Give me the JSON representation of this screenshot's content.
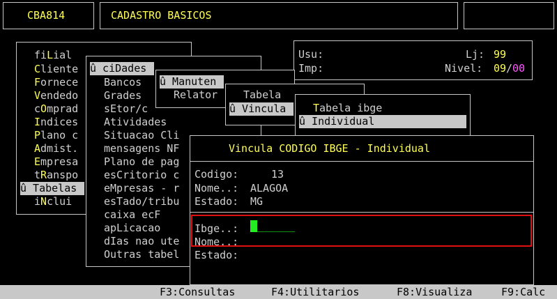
{
  "header": {
    "code": "CBA814",
    "title": "CADASTRO BASICOS"
  },
  "main_menu": {
    "items": [
      {
        "hot": "fi",
        "hot_key": "L",
        "rest": "ial",
        "selected": false
      },
      {
        "hot": "C",
        "rest": "liente",
        "selected": false
      },
      {
        "hot": "F",
        "rest": "ornece",
        "selected": false
      },
      {
        "hot": "V",
        "rest": "endedo",
        "selected": false
      },
      {
        "hot": "c",
        "hot_key": "O",
        "rest": "mprad",
        "selected": false
      },
      {
        "hot": "I",
        "rest": "ndices",
        "selected": false
      },
      {
        "hot": "P",
        "rest": "lano c",
        "selected": false
      },
      {
        "hot": "A",
        "rest": "dmist.",
        "selected": false
      },
      {
        "hot": "E",
        "rest": "mpresa",
        "selected": false
      },
      {
        "hot": "t",
        "hot_key": "R",
        "rest": "anspo",
        "selected": false
      },
      {
        "label": "û Tabelas",
        "selected": true
      },
      {
        "hot": "i",
        "hot_key": "N",
        "rest": "clui",
        "selected": false
      }
    ]
  },
  "tabelas_menu": {
    "title": "û ciDades",
    "items": [
      "Bancos",
      "Grades",
      "sEtor/c",
      "Atividades",
      "Situacao Cli",
      "mensagens NF",
      "Plano de pag",
      "esCritorio c",
      "eMpresas - r",
      "esTado/tribu",
      "caixa ecF",
      "apLicacao",
      "dIas nao ute",
      "Outras tabel"
    ]
  },
  "cidades_menu": {
    "items": [
      "û Manuten",
      "Relator"
    ]
  },
  "manut_menu": {
    "items": [
      "Tabela",
      "û Vincula"
    ]
  },
  "vincula_menu": {
    "items": [
      "Tabela ibge",
      "û Individual"
    ]
  },
  "user_panel": {
    "usu_label": "Usu:",
    "lj_label": "Lj:",
    "lj_value": "99",
    "imp_label": "Imp:",
    "nivel_label": "Nivel:",
    "nivel_value": "09",
    "nivel_sep": "/",
    "nivel_max": "00"
  },
  "dialog": {
    "title": "Vincula CODIGO IBGE - Individual",
    "codigo_label": "Codigo:",
    "codigo_value": "13",
    "nome_label": "Nome..:",
    "nome_value": "ALAGOA",
    "estado_label": "Estado:",
    "estado_value": "MG",
    "ibge_label": "Ibge..:",
    "ibge_value": "______",
    "nome2_label": "Nome..:",
    "estado2_label": "Estado:"
  },
  "function_bar": {
    "f3": "F3:Consultas",
    "f4": "F4:Utilitarios",
    "f8": "F8:Visualiza",
    "f9": "F9:Calc"
  },
  "colors": {
    "background": "#000000",
    "text": "#d0d0d0",
    "hotkey": "#ffff55",
    "highlight": "#ff55ff",
    "selection": "#c8c8c8",
    "cursor": "#22ee22",
    "focus_border": "#e01010"
  }
}
